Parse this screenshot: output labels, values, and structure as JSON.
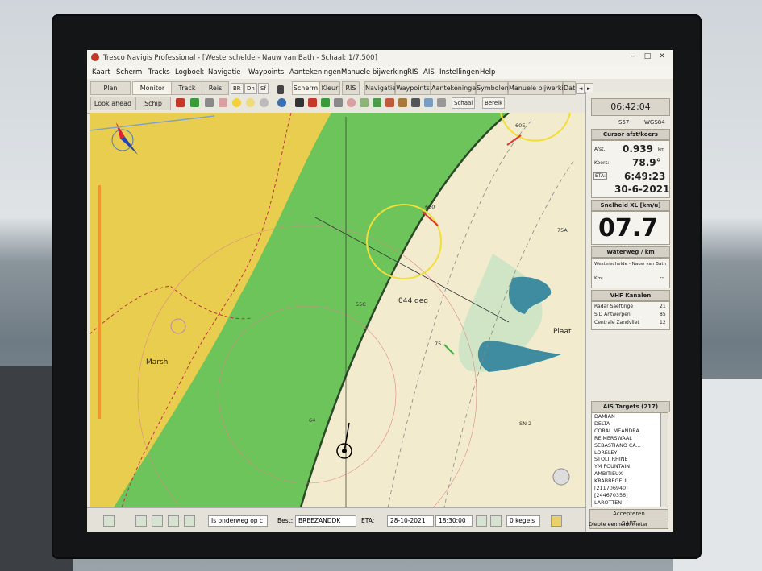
{
  "window": {
    "title": "Tresco Navigis Professional - [Westerschelde - Nauw van Bath - Schaal: 1/7,500]",
    "controls": {
      "minimize": "–",
      "maximize": "□",
      "close": "✕"
    }
  },
  "menu": [
    "Kaart",
    "Scherm",
    "Tracks",
    "Logboek",
    "Navigatie",
    "Waypoints",
    "Aantekeningen",
    "Manuele bijwerking",
    "RIS",
    "AIS",
    "Instellingen",
    "Help"
  ],
  "toolbar": {
    "plan": "Plan",
    "monitor": "Monitor",
    "track": "Track",
    "reis": "Reis",
    "lookahead": "Look ahead",
    "schip": "Schip",
    "tabs": [
      "Scherm",
      "Kleur",
      "RIS",
      "Navigatie",
      "Waypoints",
      "Aantekeningen",
      "Symbolen",
      "Manuele bijwerking",
      "Dat"
    ],
    "schaal": "Schaal",
    "bereik": "Bereik"
  },
  "map": {
    "label_marsh": "Marsh",
    "label_course": "044 deg",
    "label_plaat": "Plaat",
    "depths": [
      "60E",
      "660",
      "75A",
      "55C",
      "75",
      "SN 2",
      "64"
    ]
  },
  "panel": {
    "clock": "06:42:04",
    "s57": "S57",
    "wgs84": "WGS84",
    "cursor_title": "Cursor afst/koers",
    "afst_label": "Afst.:",
    "afst_value": "0.939",
    "afst_unit": "km",
    "koers_label": "Koers:",
    "koers_value": "78.9°",
    "eta_label": "ETA:",
    "eta_time": "6:49:23",
    "eta_date": "30-6-2021",
    "speed_title": "Snelheid XL [km/u]",
    "speed_value": "07.7",
    "waterweg_title": "Waterweg / km",
    "waterweg_name": "Westerschelde - Nauw van Bath",
    "km_label": "Km:",
    "km_value": "--",
    "vhf_title": "VHF Kanalen",
    "vhf": [
      {
        "name": "Radar Saeftinge",
        "ch": "21"
      },
      {
        "name": "SID Antwerpen",
        "ch": "85"
      },
      {
        "name": "Centrale Zandvliet",
        "ch": "12"
      }
    ],
    "ais_title": "AIS Targets (217)",
    "ais_targets": [
      "DAMIAN",
      "DELTA",
      "CORAL MEANDRA",
      "REIMERSWAAL",
      "SEBASTIANO CA...",
      "LORELEY",
      "STOLT RHINE",
      "YM FOUNTAIN",
      "AMBITIEUX",
      "KRABBEGEUL",
      "[211706940]",
      "[244670356]",
      "LAROTTEN"
    ],
    "accept_button": "Accepteren",
    "sart_button": "SART",
    "depth_unit": "Diepte eenheid: meter"
  },
  "statusbar": {
    "mode": "Is onderweg op c",
    "best_label": "Best:",
    "best_value": "BREEZANDDK",
    "eta_label": "ETA:",
    "eta_date": "28-10-2021",
    "eta_time": "18:30:00",
    "kegels": "0 kegels"
  },
  "colors": {
    "land": "#e8cd4e",
    "green": "#6cc45a",
    "water": "#f2ebcd",
    "deep": "#3f8ca0",
    "accent": "#1f6fb5"
  }
}
